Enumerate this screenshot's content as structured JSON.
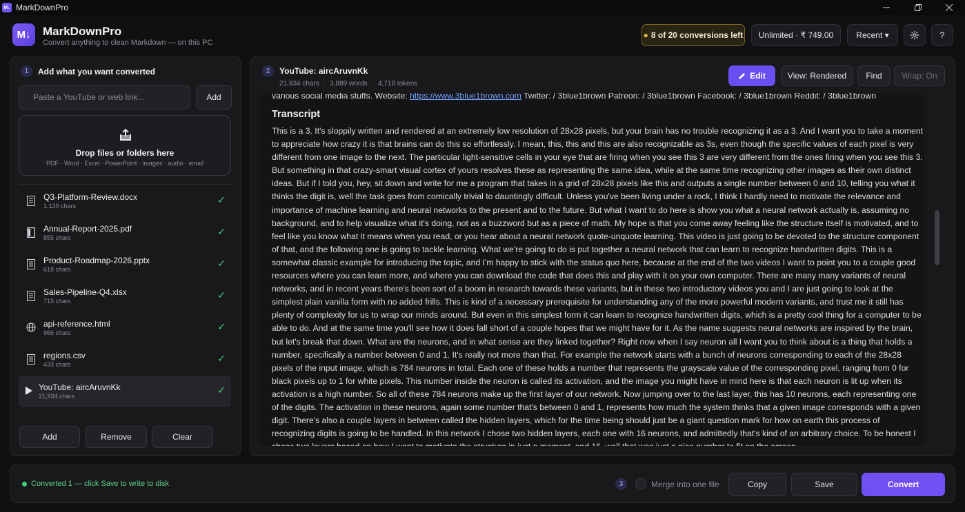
{
  "window": {
    "title": "MarkDownPro",
    "logo_text": "M↓"
  },
  "header": {
    "app_name": "MarkDownPro",
    "tagline": "Convert anything to clean Markdown — on this PC",
    "quota": "8 of 20 conversions left",
    "plan": "Unlimited · ₹ 749.00",
    "recent": "Recent ▾"
  },
  "left": {
    "step": "1",
    "title": "Add what you want converted",
    "input_placeholder": "Paste a YouTube or web link...",
    "add_link_label": "Add",
    "drop_title": "Drop files or folders here",
    "drop_sub": "PDF · Word · Excel · PowerPoint · images · audio · email",
    "files": [
      {
        "name": "Q3-Platform-Review.docx",
        "chars": "1,139 chars",
        "icon": "document-icon"
      },
      {
        "name": "Annual-Report-2025.pdf",
        "chars": "855 chars",
        "icon": "pdf-icon"
      },
      {
        "name": "Product-Roadmap-2026.pptx",
        "chars": "618 chars",
        "icon": "document-icon"
      },
      {
        "name": "Sales-Pipeline-Q4.xlsx",
        "chars": "715 chars",
        "icon": "document-icon"
      },
      {
        "name": "api-reference.html",
        "chars": "966 chars",
        "icon": "globe-icon"
      },
      {
        "name": "regions.csv",
        "chars": "433 chars",
        "icon": "document-icon"
      },
      {
        "name": "YouTube: aircAruvnKk",
        "chars": "21,934 chars",
        "icon": "play-icon"
      }
    ],
    "add_label": "Add",
    "remove_label": "Remove",
    "clear_label": "Clear"
  },
  "right": {
    "step": "2",
    "title": "YouTube: aircAruvnKk",
    "chars": "21,934 chars",
    "words": "3,889 words",
    "tokens": "4,718 tokens",
    "edit_label": "Edit",
    "view_label": "View: Rendered",
    "find_label": "Find",
    "wrap_label": "Wrap: On",
    "top_line_before": "various social media stuffs. Website: ",
    "top_line_link": "https://www.3blue1brown.com",
    "top_line_after": " Twitter: / 3blue1brown Patreon: / 3blue1brown Facebook: / 3blue1brown Reddit: / 3blue1brown",
    "transcript_heading": "Transcript",
    "transcript": "This is a 3. It's sloppily written and rendered at an extremely low resolution of 28x28 pixels, but your brain has no trouble recognizing it as a 3. And I want you to take a moment to appreciate how crazy it is that brains can do this so effortlessly. I mean, this, this and this are also recognizable as 3s, even though the specific values of each pixel is very different from one image to the next. The particular light-sensitive cells in your eye that are firing when you see this 3 are very different from the ones firing when you see this 3. But something in that crazy-smart visual cortex of yours resolves these as representing the same idea, while at the same time recognizing other images as their own distinct ideas. But if I told you, hey, sit down and write for me a program that takes in a grid of 28x28 pixels like this and outputs a single number between 0 and 10, telling you what it thinks the digit is, well the task goes from comically trivial to dauntingly difficult. Unless you've been living under a rock, I think I hardly need to motivate the relevance and importance of machine learning and neural networks to the present and to the future. But what I want to do here is show you what a neural network actually is, assuming no background, and to help visualize what it's doing, not as a buzzword but as a piece of math. My hope is that you come away feeling like the structure itself is motivated, and to feel like you know what it means when you read, or you hear about a neural network quote-unquote learning. This video is just going to be devoted to the structure component of that, and the following one is going to tackle learning. What we're going to do is put together a neural network that can learn to recognize handwritten digits. This is a somewhat classic example for introducing the topic, and I'm happy to stick with the status quo here, because at the end of the two videos I want to point you to a couple good resources where you can learn more, and where you can download the code that does this and play with it on your own computer. There are many many variants of neural networks, and in recent years there's been sort of a boom in research towards these variants, but in these two introductory videos you and I are just going to look at the simplest plain vanilla form with no added frills. This is kind of a necessary prerequisite for understanding any of the more powerful modern variants, and trust me it still has plenty of complexity for us to wrap our minds around. But even in this simplest form it can learn to recognize handwritten digits, which is a pretty cool thing for a computer to be able to do. And at the same time you'll see how it does fall short of a couple hopes that we might have for it. As the name suggests neural networks are inspired by the brain, but let's break that down. What are the neurons, and in what sense are they linked together? Right now when I say neuron all I want you to think about is a thing that holds a number, specifically a number between 0 and 1. It's really not more than that. For example the network starts with a bunch of neurons corresponding to each of the 28x28 pixels of the input image, which is 784 neurons in total. Each one of these holds a number that represents the grayscale value of the corresponding pixel, ranging from 0 for black pixels up to 1 for white pixels. This number inside the neuron is called its activation, and the image you might have in mind here is that each neuron is lit up when its activation is a high number. So all of these 784 neurons make up the first layer of our network. Now jumping over to the last layer, this has 10 neurons, each representing one of the digits. The activation in these neurons, again some number that's between 0 and 1, represents how much the system thinks that a given image corresponds with a given digit. There's also a couple layers in between called the hidden layers, which for the time being should just be a giant question mark for how on earth this process of recognizing digits is going to be handled. In this network I chose two hidden layers, each one with 16 neurons, and admittedly that's kind of an arbitrary choice. To be honest I chose two layers based on how I want to motivate the structure in just a moment, and 16, well that was just a nice number to fit on the screen."
  },
  "status": {
    "message": "Converted 1 — click Save to write to disk",
    "step": "3",
    "merge_label": "Merge into one file",
    "copy_label": "Copy",
    "save_label": "Save",
    "convert_label": "Convert"
  },
  "colors": {
    "accent": "#6a4ff0",
    "success": "#42d17a",
    "quota_border": "#7a6426"
  }
}
